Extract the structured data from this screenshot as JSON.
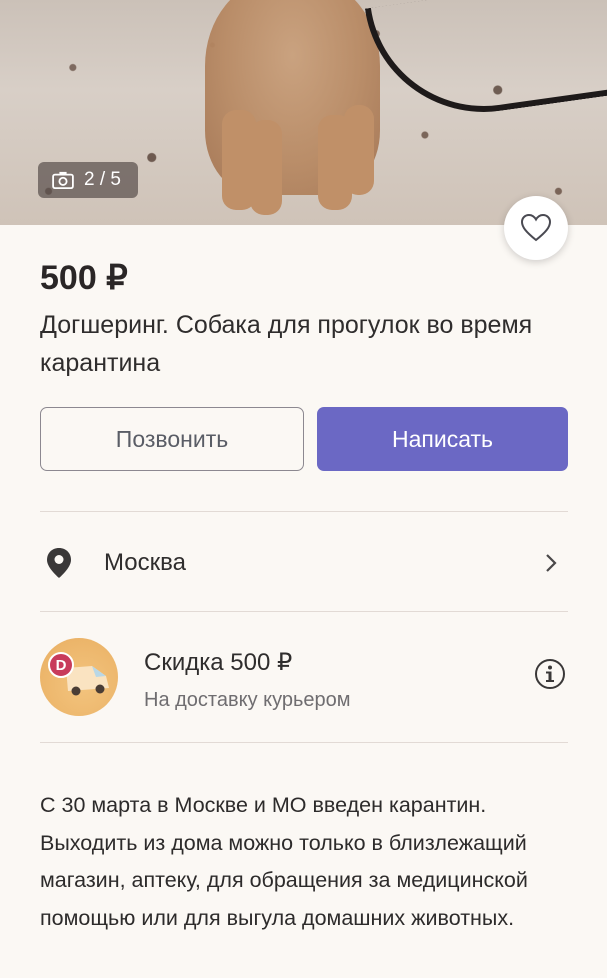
{
  "photo": {
    "counter": "2 / 5",
    "counter_icon": "camera-icon"
  },
  "favorite": {
    "icon": "heart-icon"
  },
  "listing": {
    "price": "500 ₽",
    "title": "Догшеринг. Собака для прогулок во время карантина"
  },
  "actions": {
    "call_label": "Позвонить",
    "write_label": "Написать"
  },
  "location": {
    "city": "Москва",
    "icon": "location-pin-icon"
  },
  "promo": {
    "title": "Скидка 500 ₽",
    "subtitle": "На доставку курьером",
    "badge_letter": "D"
  },
  "description": "С 30 марта в Москве и МО введен карантин. Выходить из дома можно только в близлежащий магазин, аптеку, для обращения за медицинской помощью или для выгула домашних животных.",
  "colors": {
    "accent": "#6b68c4",
    "background": "#fbf8f4",
    "badge": "#c83b5b"
  }
}
